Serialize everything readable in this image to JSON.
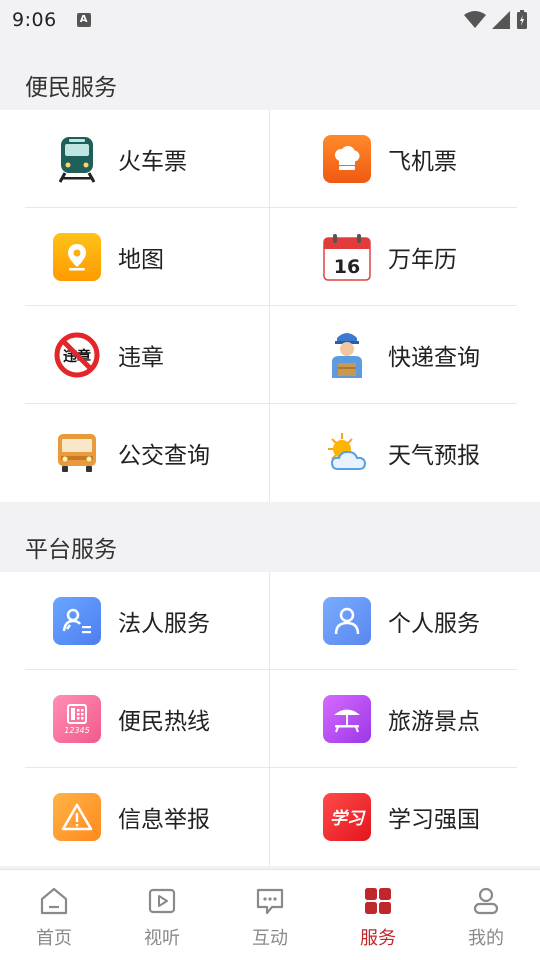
{
  "status_bar": {
    "time": "9:06",
    "notification_icon": "A"
  },
  "sections": [
    {
      "title": "便民服务",
      "items": [
        {
          "label": "火车票",
          "icon": "train-icon"
        },
        {
          "label": "飞机票",
          "icon": "chef-hat-icon"
        },
        {
          "label": "地图",
          "icon": "map-pin-icon"
        },
        {
          "label": "万年历",
          "icon": "calendar-icon",
          "icon_text": "16"
        },
        {
          "label": "违章",
          "icon": "violation-icon",
          "icon_text": "违章"
        },
        {
          "label": "快递查询",
          "icon": "courier-icon"
        },
        {
          "label": "公交查询",
          "icon": "bus-icon"
        },
        {
          "label": "天气预报",
          "icon": "weather-icon"
        }
      ]
    },
    {
      "title": "平台服务",
      "items": [
        {
          "label": "法人服务",
          "icon": "legal-person-icon"
        },
        {
          "label": "个人服务",
          "icon": "person-icon"
        },
        {
          "label": "便民热线",
          "icon": "hotline-icon",
          "icon_text": "12345"
        },
        {
          "label": "旅游景点",
          "icon": "tourism-icon"
        },
        {
          "label": "信息举报",
          "icon": "warning-icon"
        },
        {
          "label": "学习强国",
          "icon": "xuexi-icon",
          "icon_text": "学习"
        }
      ]
    }
  ],
  "tabbar": [
    {
      "label": "首页",
      "icon": "home-icon",
      "active": false
    },
    {
      "label": "视听",
      "icon": "play-icon",
      "active": false
    },
    {
      "label": "互动",
      "icon": "chat-icon",
      "active": false
    },
    {
      "label": "服务",
      "icon": "grid-icon",
      "active": true
    },
    {
      "label": "我的",
      "icon": "user-icon",
      "active": false
    }
  ],
  "colors": {
    "accent": "#c0272d",
    "background": "#f2f2f4"
  }
}
